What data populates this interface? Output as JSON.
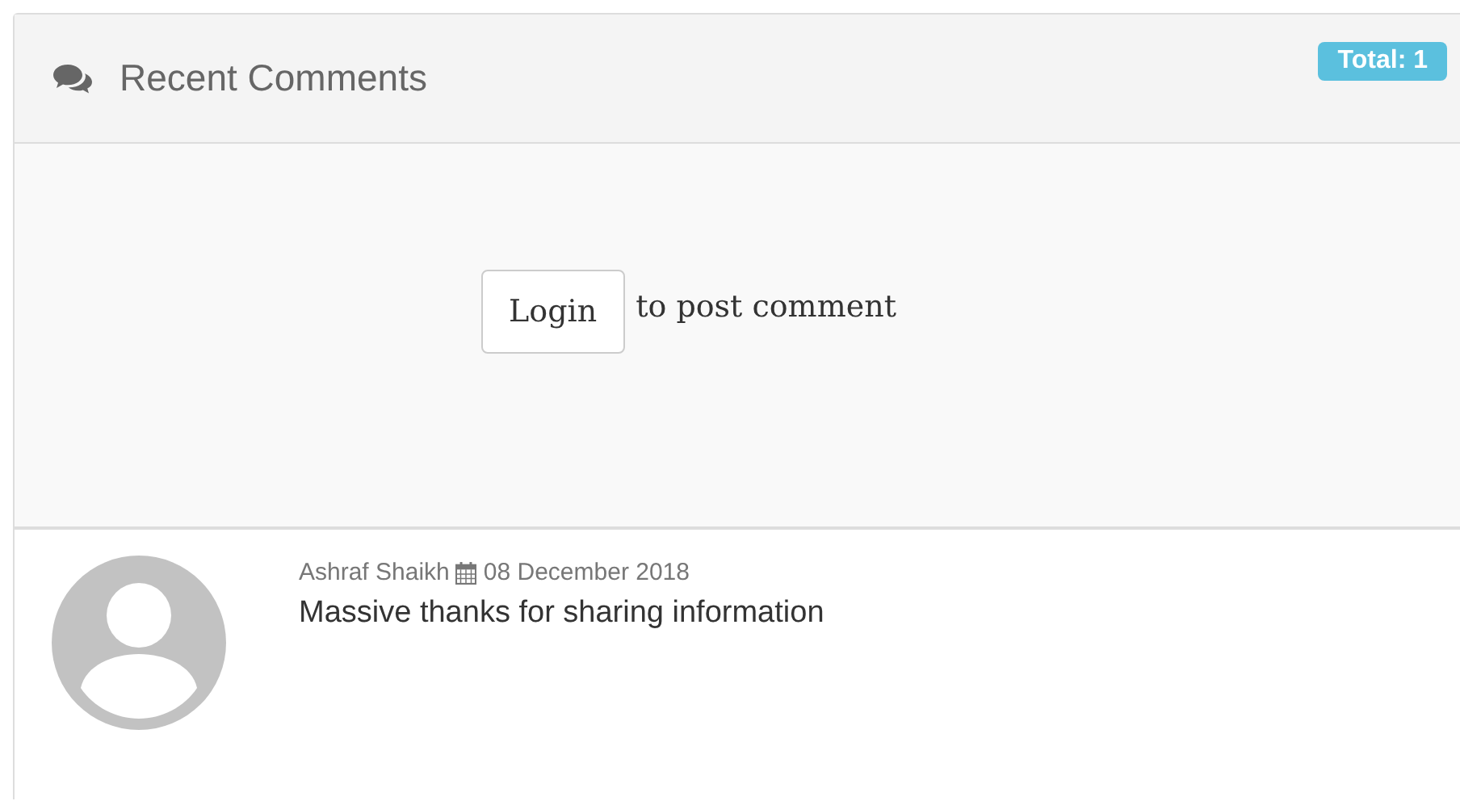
{
  "panel": {
    "title": "Recent Comments",
    "badge": "Total: 1"
  },
  "login": {
    "button": "Login",
    "text": "to post comment"
  },
  "comments": [
    {
      "author": "Ashraf Shaikh",
      "date": "08 December 2018",
      "text": "Massive thanks for sharing information"
    }
  ]
}
